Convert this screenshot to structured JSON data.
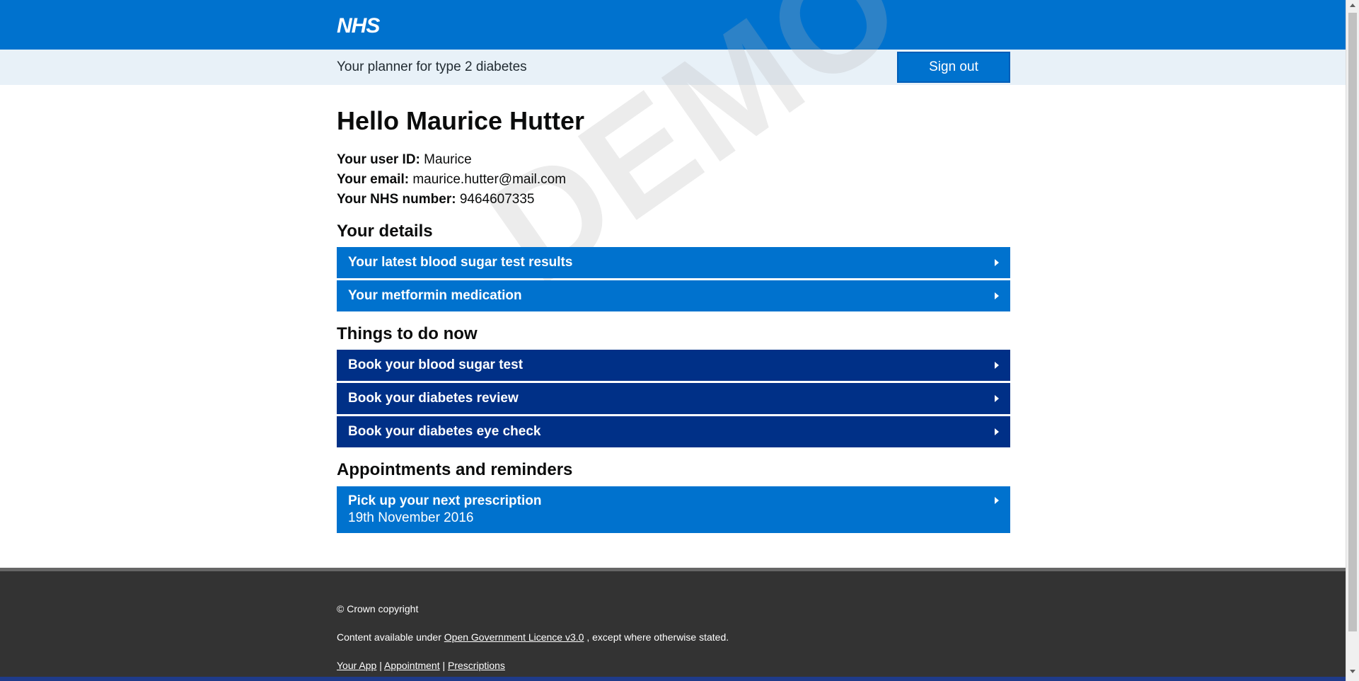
{
  "header": {
    "logo_text": "NHS",
    "planner_title": "Your planner for type 2 diabetes",
    "signout_label": "Sign out"
  },
  "watermark": "DEMO",
  "profile": {
    "greeting": "Hello Maurice Hutter",
    "user_id_label": "Your user ID:",
    "user_id": "Maurice",
    "email_label": "Your email:",
    "email": "maurice.hutter@mail.com",
    "nhs_label": "Your NHS number:",
    "nhs_number": "9464607335"
  },
  "details": {
    "heading": "Your details",
    "items": [
      {
        "label": "Your latest blood sugar test results"
      },
      {
        "label": "Your metformin medication"
      }
    ]
  },
  "todo": {
    "heading": "Things to do now",
    "items": [
      {
        "label": "Book your blood sugar test"
      },
      {
        "label": "Book your diabetes review"
      },
      {
        "label": "Book your diabetes eye check"
      }
    ]
  },
  "appointments": {
    "heading": "Appointments and reminders",
    "items": [
      {
        "label": "Pick up your next prescription",
        "date": "19th November 2016"
      }
    ]
  },
  "footer": {
    "copyright": "© Crown copyright",
    "licence_prefix": "Content available under",
    "licence_link": "Open Government Licence v3.0",
    "licence_suffix": ", except where otherwise stated.",
    "links": [
      "Your App",
      "Appointment",
      "Prescriptions"
    ],
    "separator": "|"
  },
  "colors": {
    "nhs_blue": "#0072ce",
    "dark_blue": "#003087",
    "subbar": "#e8f1f8",
    "footer": "#333333"
  }
}
